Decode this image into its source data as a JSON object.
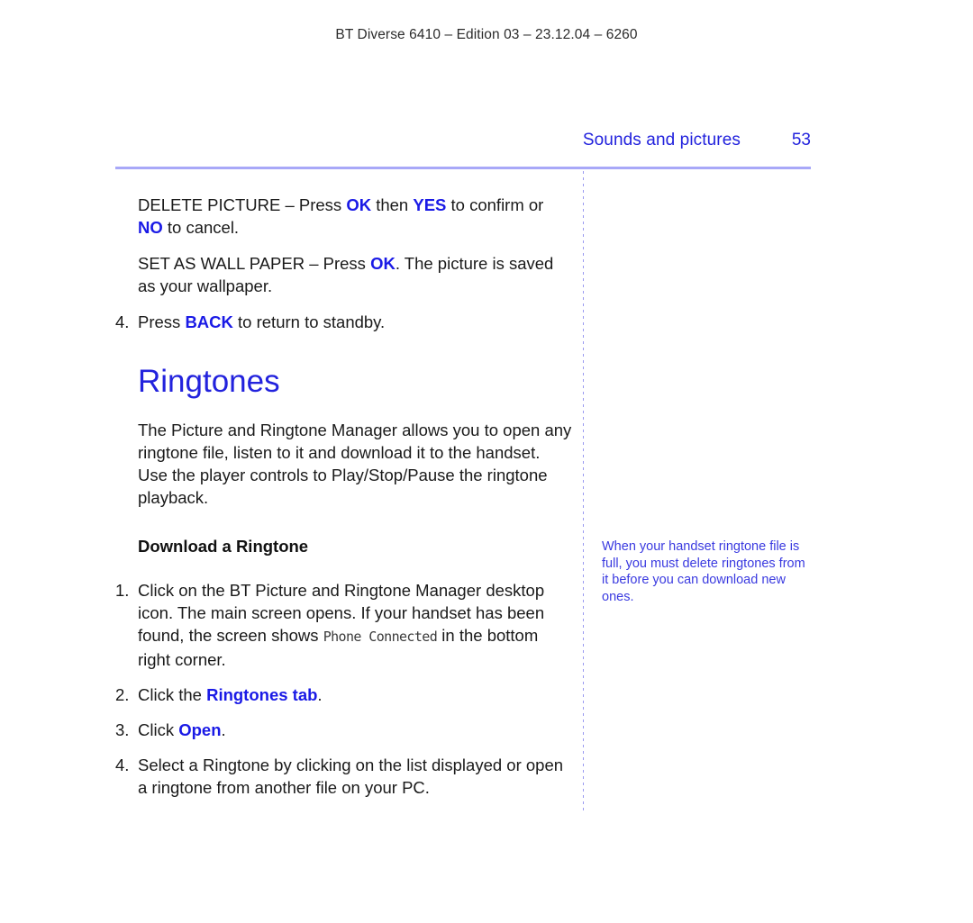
{
  "running_head": "BT Diverse 6410 – Edition 03 – 23.12.04 – 6260",
  "header": {
    "section_title": "Sounds and pictures",
    "page_number": "53"
  },
  "colors": {
    "heading_blue": "#2222dd",
    "keyword_blue": "#1a1ae6",
    "sidenote_blue": "#3a3ae0",
    "rule_lavender": "#a8a8f8",
    "body_text": "#1a1a1a"
  },
  "main": {
    "paragraphs": [
      {
        "id": "delete-picture",
        "segments": [
          {
            "text": "DELETE PICTURE – Press ",
            "style": "normal"
          },
          {
            "text": "OK",
            "style": "keyword"
          },
          {
            "text": " then ",
            "style": "normal"
          },
          {
            "text": "YES",
            "style": "keyword"
          },
          {
            "text": " to confirm or ",
            "style": "normal"
          },
          {
            "text": "NO",
            "style": "keyword"
          },
          {
            "text": " to cancel.",
            "style": "normal"
          }
        ]
      },
      {
        "id": "set-as-wall-paper",
        "segments": [
          {
            "text": "SET AS WALL PAPER – Press ",
            "style": "normal"
          },
          {
            "text": "OK",
            "style": "keyword"
          },
          {
            "text": ". The picture is saved as your wallpaper.",
            "style": "normal"
          }
        ]
      }
    ],
    "step_back": {
      "number": "4.",
      "segments": [
        {
          "text": "Press ",
          "style": "normal"
        },
        {
          "text": "BACK",
          "style": "keyword"
        },
        {
          "text": " to return to standby.",
          "style": "normal"
        }
      ]
    },
    "chapter_heading": "Ringtones",
    "intro_paragraph": "The Picture and Ringtone Manager allows you to open any ringtone file, listen to it and download it to the handset. Use the player controls to Play/Stop/Pause the ringtone playback.",
    "sub_heading": "Download a Ringtone",
    "steps": [
      {
        "number": "1.",
        "segments": [
          {
            "text": "Click on the BT Picture and Ringtone Manager desktop icon. The main screen opens. If your handset has been found, the screen shows ",
            "style": "normal"
          },
          {
            "text": "Phone Connected",
            "style": "lcd"
          },
          {
            "text": " in the bottom right corner.",
            "style": "normal"
          }
        ]
      },
      {
        "number": "2.",
        "segments": [
          {
            "text": "Click the ",
            "style": "normal"
          },
          {
            "text": "Ringtones tab",
            "style": "keyword"
          },
          {
            "text": ".",
            "style": "normal"
          }
        ]
      },
      {
        "number": "3.",
        "segments": [
          {
            "text": "Click ",
            "style": "normal"
          },
          {
            "text": "Open",
            "style": "keyword"
          },
          {
            "text": ".",
            "style": "normal"
          }
        ]
      },
      {
        "number": "4.",
        "segments": [
          {
            "text": "Select a Ringtone by clicking on the list displayed or open a ringtone from another file on your PC.",
            "style": "normal"
          }
        ]
      }
    ]
  },
  "side_note": {
    "text": "When your handset ringtone file is full, you must delete ringtones from it before you can download new ones."
  }
}
